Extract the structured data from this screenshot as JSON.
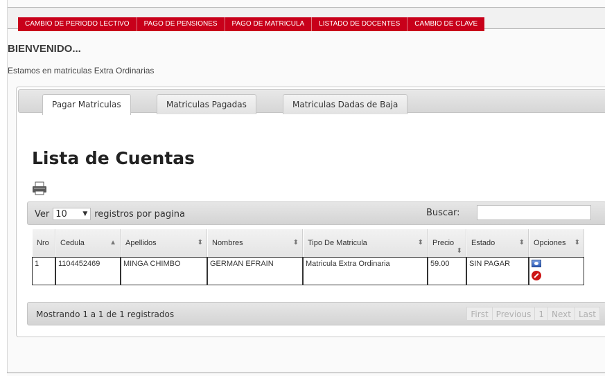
{
  "menu": {
    "items": [
      {
        "label": "CAMBIO DE PERIODO LECTIVO"
      },
      {
        "label": "PAGO DE PENSIONES"
      },
      {
        "label": "PAGO DE MATRICULA"
      },
      {
        "label": "LISTADO DE DOCENTES"
      },
      {
        "label": "CAMBIO DE CLAVE"
      }
    ]
  },
  "page": {
    "welcome": "BIENVENIDO...",
    "subtitle": "Estamos en matriculas Extra Ordinarias",
    "heading": "Lista de Cuentas"
  },
  "tabs": [
    {
      "label": "Pagar Matriculas",
      "active": true
    },
    {
      "label": "Matriculas Pagadas",
      "active": false
    },
    {
      "label": "Matriculas Dadas de Baja",
      "active": false
    }
  ],
  "table_controls": {
    "length_prefix": "Ver",
    "length_value": "10",
    "length_suffix": "registros por pagina",
    "search_label": "Buscar:",
    "search_value": ""
  },
  "table": {
    "columns": [
      "Nro",
      "Cedula",
      "Apellidos",
      "Nombres",
      "Tipo De Matricula",
      "Precio",
      "Estado",
      "Opciones"
    ],
    "rows": [
      {
        "nro": "1",
        "cedula": "1104452469",
        "apellidos": "MINGA CHIMBO",
        "nombres": "GERMAN EFRAIN",
        "tipo": "Matricula Extra Ordinaria",
        "precio": "59.00",
        "estado": "SIN PAGAR"
      }
    ]
  },
  "footer": {
    "info": "Mostrando 1 a 1 de 1 registrados",
    "pager": {
      "first": "First",
      "previous": "Previous",
      "page": "1",
      "next": "Next",
      "last": "Last"
    }
  },
  "icons": {
    "print": "printer-icon",
    "sort_asc": "sort-ascending-icon",
    "sort_both": "sort-both-icon",
    "view": "view-icon",
    "delete": "delete-icon",
    "select_arrow": "chevron-down-icon"
  },
  "colors": {
    "menu_bg": "#c8001a",
    "menu_text": "#ffffff",
    "delete_icon": "#cc1414",
    "view_icon": "#2b58b4"
  }
}
